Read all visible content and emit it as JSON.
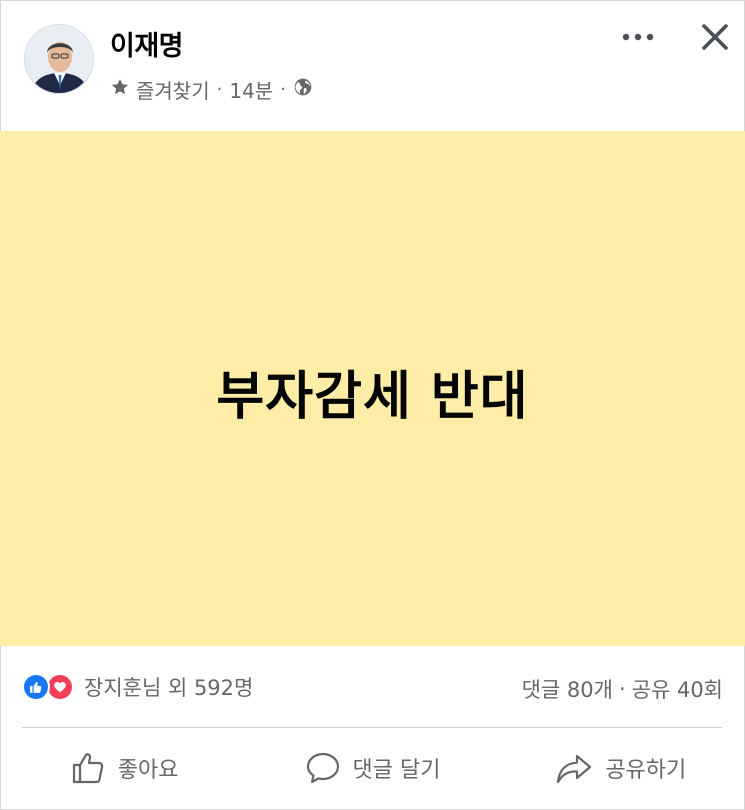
{
  "post": {
    "author": "이재명",
    "meta": {
      "favorites_label": "즐겨찾기",
      "time": "14분",
      "separator": "·",
      "audience_icon": "globe-icon",
      "favorites_icon": "star-icon"
    },
    "text": "부자감세 반대",
    "background_color": "#fdeda6"
  },
  "toolbar": {
    "more_icon": "more-dots-icon",
    "close_icon": "close-icon"
  },
  "stats": {
    "reactions_text": "장지훈님 외 592명",
    "comments": "댓글 80개",
    "separator": "·",
    "shares": "공유 40회",
    "reaction_icons": [
      "like-icon",
      "love-icon"
    ]
  },
  "actions": {
    "like_label": "좋아요",
    "comment_label": "댓글 달기",
    "share_label": "공유하기"
  },
  "colors": {
    "like_blue": "#1877f2",
    "love_red": "#f33e58",
    "secondary_text": "#65676b"
  }
}
